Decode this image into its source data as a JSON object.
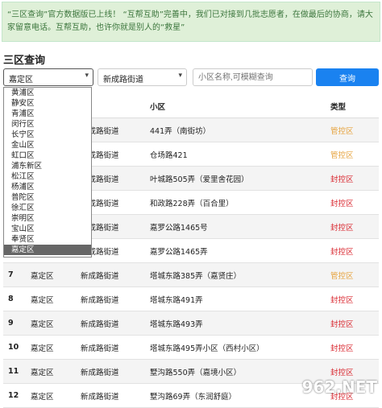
{
  "notice": "“三区查询”官方数据版已上线！ “互帮互助”完善中，我们已对接到几批志愿者，在做最后的协商，请大家留意电话。互帮互助，也许你就是别人的“救星”",
  "page_title": "三区查询",
  "filters": {
    "district": "嘉定区",
    "street": "新成路街道",
    "search_placeholder": "小区名称,可模糊查询",
    "query_label": "查询"
  },
  "dropdown_options": [
    "黄浦区",
    "静安区",
    "青浦区",
    "闵行区",
    "长宁区",
    "金山区",
    "虹口区",
    "浦东新区",
    "松江区",
    "杨浦区",
    "普陀区",
    "徐汇区",
    "崇明区",
    "宝山区",
    "奉贤区",
    "嘉定区"
  ],
  "table": {
    "headers": [
      "",
      "",
      "道",
      "小区",
      "类型"
    ],
    "rows": [
      [
        "",
        "",
        "新成路街道",
        "441弄（南街坊）",
        "管控区"
      ],
      [
        "",
        "",
        "新成路街道",
        "仓场路421",
        "管控区"
      ],
      [
        "",
        "",
        "新成路街道",
        "叶城路505弄（爱里舍花园）",
        "封控区"
      ],
      [
        "",
        "",
        "新成路街道",
        "和政路228弄（百合里）",
        "封控区"
      ],
      [
        "",
        "",
        "新成路街道",
        "嘉罗公路1465号",
        "封控区"
      ],
      [
        "",
        "",
        "新成路街道",
        "嘉罗公路1465弄",
        "封控区"
      ],
      [
        "7",
        "嘉定区",
        "新成路街道",
        "塔城东路385弄（嘉贤庄）",
        "管控区"
      ],
      [
        "8",
        "嘉定区",
        "新成路街道",
        "塔城东路491弄",
        "封控区"
      ],
      [
        "9",
        "嘉定区",
        "新成路街道",
        "塔城东路493弄",
        "封控区"
      ],
      [
        "10",
        "嘉定区",
        "新成路街道",
        "塔城东路495弄小区（西村小区）",
        "封控区"
      ],
      [
        "11",
        "嘉定区",
        "新成路街道",
        "墅沟路550弄（嘉境小区）",
        "封控区"
      ],
      [
        "12",
        "嘉定区",
        "新成路街道",
        "墅沟路69弄（东润舒庭）",
        "封控区"
      ]
    ]
  },
  "watermark": "962.NET",
  "colors": {
    "管控区": "#e6a23c",
    "封控区": "#d9262e"
  }
}
